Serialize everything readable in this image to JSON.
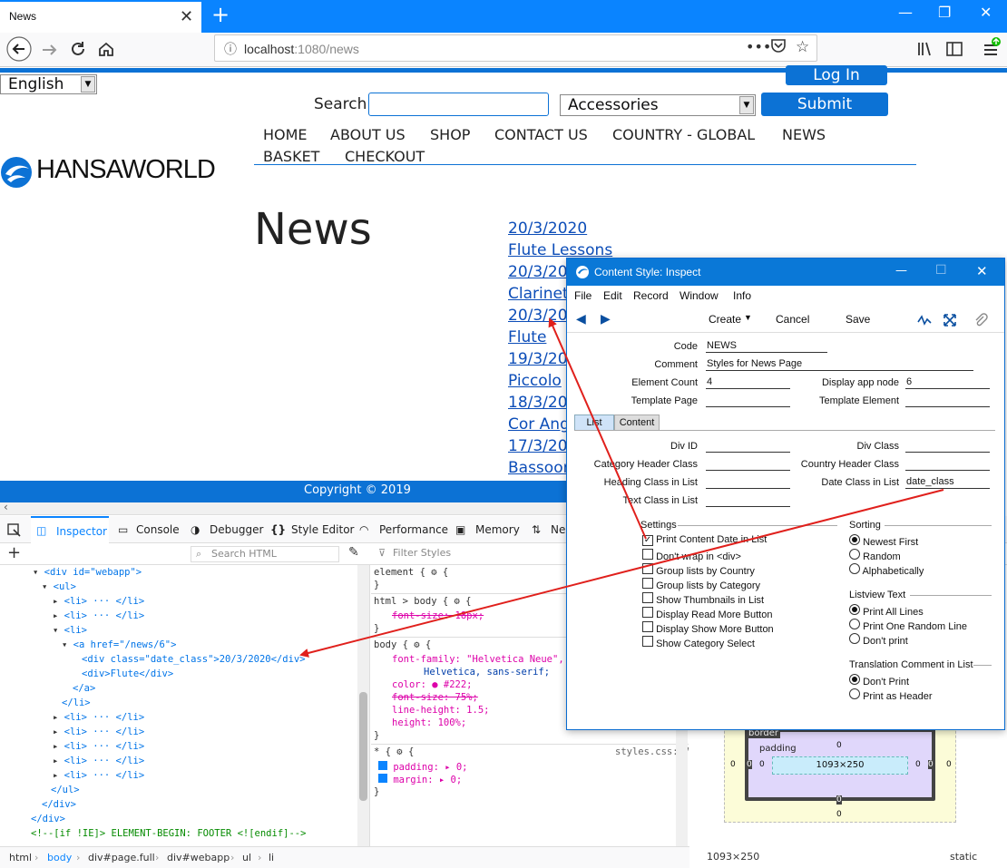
{
  "browser": {
    "tab_title": "News",
    "url_host": "localhost",
    "url_path": ":1080/news",
    "close": "✕",
    "new_tab": "+",
    "win_min": "—",
    "win_max": "❐",
    "win_close": "✕",
    "more": "•••"
  },
  "page": {
    "language": "English",
    "login": "Log In",
    "search_label": "Search",
    "search_value": "",
    "category": "Accessories",
    "submit": "Submit",
    "menu_row1": [
      "HOME",
      "ABOUT US",
      "SHOP",
      "CONTACT US",
      "COUNTRY - GLOBAL",
      "NEWS"
    ],
    "menu_row2": [
      "BASKET",
      "CHECKOUT"
    ],
    "logo": "HANSAWORLD",
    "title": "News",
    "news": [
      "20/3/2020",
      "Flute Lessons",
      "20/3/20",
      "Clarinet",
      "20/3/20",
      "Flute",
      "19/3/20",
      "Piccolo",
      "18/3/20",
      "Cor Ang",
      "17/3/20",
      "Bassoon"
    ],
    "footer": "Copyright © 2019"
  },
  "devtools": {
    "tabs": [
      "Inspector",
      "Console",
      "Debugger",
      "Style Editor",
      "Performance",
      "Memory",
      "Ne"
    ],
    "search_html": "Search HTML",
    "filter_styles": "Filter Styles",
    "html_lines": [
      "<div id=\"webapp\">",
      "<ul>",
      "<li> ··· </li>",
      "<li> ··· </li>",
      "<li>",
      "<a href=\"/news/6\">",
      "<div class=\"date_class\">20/3/2020</div>",
      "<div>Flute</div>",
      "</a>",
      "</li>",
      "<li> ··· </li>",
      "<li> ··· </li>",
      "<li> ··· </li>",
      "<li> ··· </li>",
      "<li> ··· </li>",
      "</ul>",
      "</div>",
      "</div>",
      "<!--[if !IE]> ELEMENT-BEGIN: FOOTER <![endif]-->"
    ],
    "style_lines": [
      "element { ",
      "}",
      "html > body { ",
      "font-size: 18px;",
      "}",
      "body { ",
      "font-family: \"Helvetica Neue\", V",
      "Helvetica, sans-serif;",
      "color: ● #222;",
      "font-size: 75%;",
      "line-height: 1.5;",
      "height: 100%;",
      "}",
      "* { ",
      "padding: ▸ 0;",
      "margin: ▸ 0;",
      "}"
    ],
    "styles_source": "styles.css:27",
    "breadcrumbs": [
      "html",
      "body",
      "div#page.full",
      "div#webapp",
      "ul",
      "li"
    ],
    "box_border": "border",
    "box_padding": "padding",
    "box_content": "1093×250",
    "box_size": "1093×250",
    "position": "static",
    "zero": "0"
  },
  "inspect": {
    "title": "Content Style: Inspect",
    "menu": [
      "File",
      "Edit",
      "Record",
      "Window",
      "Info"
    ],
    "create": "Create",
    "cancel": "Cancel",
    "save": "Save",
    "fields": {
      "code_label": "Code",
      "code": "NEWS",
      "comment_label": "Comment",
      "comment": "Styles for News Page",
      "element_count_label": "Element Count",
      "element_count": "4",
      "display_app_node_label": "Display app node",
      "display_app_node": "6",
      "template_page_label": "Template Page",
      "template_page": "",
      "template_element_label": "Template Element",
      "template_element": "",
      "div_id_label": "Div ID",
      "div_id": "",
      "div_class_label": "Div Class",
      "div_class": "",
      "cat_header_label": "Category Header Class",
      "cat_header": "",
      "country_header_label": "Country Header Class",
      "country_header": "",
      "heading_label": "Heading Class in List",
      "heading": "",
      "date_class_label": "Date Class in List",
      "date_class": "date_class",
      "text_class_label": "Text Class in List",
      "text_class": ""
    },
    "tabs": [
      "List",
      "Content"
    ],
    "settings_title": "Settings",
    "settings": [
      {
        "label": "Print Content Date in List",
        "checked": true
      },
      {
        "label": "Don't wrap in <div>",
        "checked": false
      },
      {
        "label": "Group lists by Country",
        "checked": false
      },
      {
        "label": "Group lists by Category",
        "checked": false
      },
      {
        "label": "Show Thumbnails in List",
        "checked": false
      },
      {
        "label": "Display Read More Button",
        "checked": false
      },
      {
        "label": "Display Show More Button",
        "checked": false
      },
      {
        "label": "Show Category Select",
        "checked": false
      }
    ],
    "sorting_title": "Sorting",
    "sorting": [
      {
        "label": "Newest First",
        "on": true
      },
      {
        "label": "Random",
        "on": false
      },
      {
        "label": "Alphabetically",
        "on": false
      }
    ],
    "listview_title": "Listview Text",
    "listview": [
      {
        "label": "Print All Lines",
        "on": true
      },
      {
        "label": "Print One Random Line",
        "on": false
      },
      {
        "label": "Don't print",
        "on": false
      }
    ],
    "translation_title": "Translation Comment in List",
    "translation": [
      {
        "label": "Don't Print",
        "on": true
      },
      {
        "label": "Print as Header",
        "on": false
      }
    ]
  },
  "colors": {
    "accent": "#0c72d5",
    "firefox_blue": "#0a84ff",
    "arrow": "#e0201c"
  }
}
